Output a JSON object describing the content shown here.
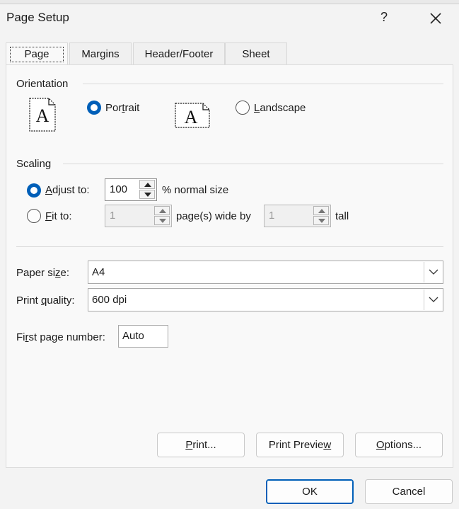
{
  "window": {
    "title": "Page Setup",
    "help_label": "?",
    "close_icon": "close-icon"
  },
  "tabs": [
    {
      "label": "Page",
      "active": true
    },
    {
      "label": "Margins",
      "active": false
    },
    {
      "label": "Header/Footer",
      "active": false
    },
    {
      "label": "Sheet",
      "active": false
    }
  ],
  "orientation": {
    "label": "Orientation",
    "portrait": {
      "label": "Portrait",
      "selected": true,
      "icon": "portrait-page-icon",
      "glyph": "A"
    },
    "landscape": {
      "label": "Landscape",
      "selected": false,
      "icon": "landscape-page-icon",
      "glyph": "A"
    }
  },
  "scaling": {
    "label": "Scaling",
    "adjust_to": {
      "label": "Adjust to:",
      "selected": true,
      "value": "100",
      "suffix": "% normal size"
    },
    "fit_to": {
      "label": "Fit to:",
      "selected": false,
      "wide_value": "1",
      "wide_suffix": "page(s) wide by",
      "tall_value": "1",
      "tall_suffix": "tall"
    }
  },
  "paper_size": {
    "label": "Paper size:",
    "value": "A4"
  },
  "print_quality": {
    "label": "Print quality:",
    "value": "600 dpi"
  },
  "first_page_number": {
    "label": "First page number:",
    "value": "Auto"
  },
  "buttons": {
    "print": "Print...",
    "print_preview": "Print Preview",
    "options": "Options...",
    "ok": "OK",
    "cancel": "Cancel"
  },
  "colors": {
    "accent": "#005fb8",
    "background": "#f3f3f3",
    "panel": "#f9f9f9"
  }
}
